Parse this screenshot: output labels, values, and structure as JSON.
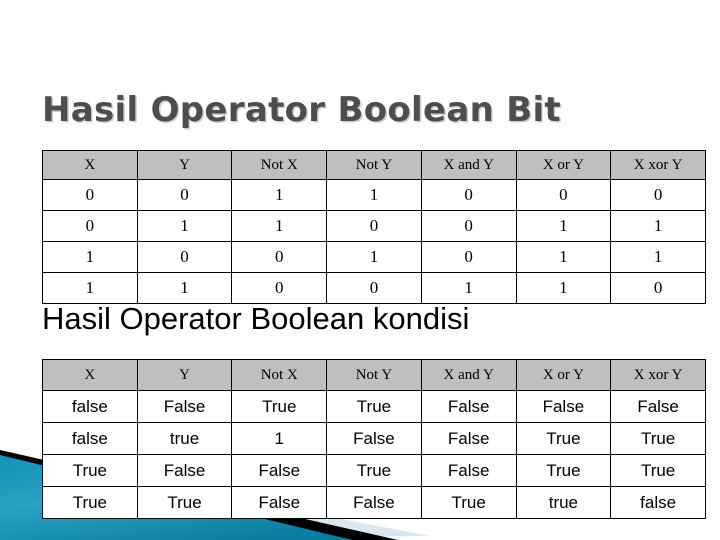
{
  "slide": {
    "background_color": "#ffffff",
    "decoration": {
      "name": "corner-wedge-graphic",
      "teal_color": "#1a93b5",
      "teal_dark": "#0d7fa0",
      "black_color": "#000000",
      "light_blue_color": "#d6e6ef"
    }
  },
  "section_bit": {
    "title": "Hasil Operator Boolean Bit",
    "title_color": "#4d4d4d",
    "table": {
      "header_bg": "#bfbfbf",
      "columns": [
        "X",
        "Y",
        "Not X",
        "Not Y",
        "X and Y",
        "X or Y",
        "X xor Y"
      ],
      "rows": [
        [
          "0",
          "0",
          "1",
          "1",
          "0",
          "0",
          "0"
        ],
        [
          "0",
          "1",
          "1",
          "0",
          "0",
          "1",
          "1"
        ],
        [
          "1",
          "0",
          "0",
          "1",
          "0",
          "1",
          "1"
        ],
        [
          "1",
          "1",
          "0",
          "0",
          "1",
          "1",
          "0"
        ]
      ]
    }
  },
  "section_kondisi": {
    "title": "Hasil Operator Boolean kondisi",
    "title_color": "#000000",
    "table": {
      "header_bg": "#bfbfbf",
      "columns": [
        "X",
        "Y",
        "Not X",
        "Not Y",
        "X and Y",
        "X or Y",
        "X xor Y"
      ],
      "rows": [
        [
          "false",
          "False",
          "True",
          "True",
          "False",
          "False",
          "False"
        ],
        [
          "false",
          "true",
          "1",
          "False",
          "False",
          "True",
          "True"
        ],
        [
          "True",
          "False",
          "False",
          "True",
          "False",
          "True",
          "True"
        ],
        [
          "True",
          "True",
          "False",
          "False",
          "True",
          "true",
          "false"
        ]
      ]
    }
  }
}
